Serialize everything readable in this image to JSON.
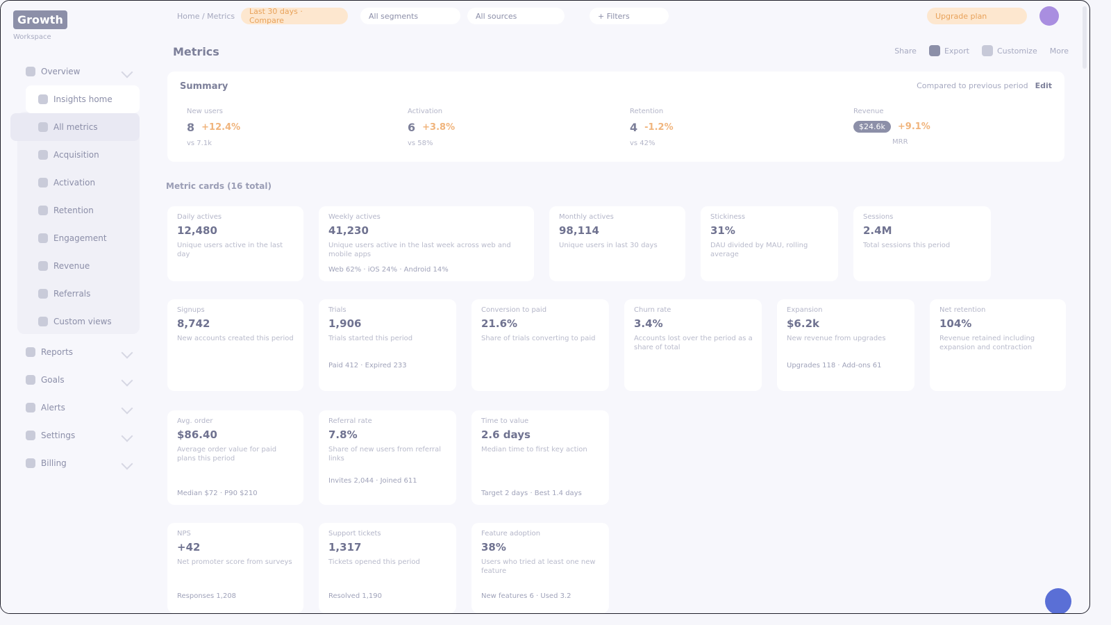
{
  "app": {
    "brand": "Growth",
    "brand_sub": "Workspace"
  },
  "sidebar": {
    "items": [
      {
        "label": "Overview"
      },
      {
        "label": "Insights home"
      },
      {
        "label": "All metrics"
      },
      {
        "label": "Acquisition"
      },
      {
        "label": "Activation"
      },
      {
        "label": "Retention"
      },
      {
        "label": "Engagement"
      },
      {
        "label": "Revenue"
      },
      {
        "label": "Referrals"
      },
      {
        "label": "Custom views"
      },
      {
        "label": "Reports"
      },
      {
        "label": "Goals"
      },
      {
        "label": "Alerts"
      },
      {
        "label": "Settings"
      },
      {
        "label": "Billing"
      }
    ]
  },
  "topbar": {
    "breadcrumb": "Home / Metrics",
    "range_pill": "Last 30 days · Compare",
    "segment_pill": "All segments",
    "source_pill": "All sources",
    "filters_pill": "+ Filters",
    "upgrade": "Upgrade plan"
  },
  "header": {
    "title": "Metrics",
    "actions": [
      "Share",
      "Export",
      "Customize",
      "More"
    ]
  },
  "summary": {
    "title": "Summary",
    "right_text": "Compared to previous period",
    "right_action": "Edit",
    "stats": [
      {
        "label": "New users",
        "num": "8",
        "val": "+12.4%",
        "foot": "vs 7.1k"
      },
      {
        "label": "Activation",
        "num": "6",
        "val": "+3.8%",
        "foot": "vs 58%"
      },
      {
        "label": "Retention",
        "num": "4",
        "val": "-1.2%",
        "foot": "vs 42%"
      },
      {
        "label": "Revenue",
        "chip": "$24.6k",
        "val": "+9.1%",
        "foot": "MRR"
      }
    ]
  },
  "section": {
    "label": "Metric cards (16 total)"
  },
  "cards": [
    {
      "title": "Daily actives",
      "value": "12,480",
      "desc": "Unique users active in the last day",
      "foot": ""
    },
    {
      "title": "Weekly actives",
      "value": "41,230",
      "desc": "Unique users active in the last week across web and mobile apps",
      "foot": "Web 62% · iOS 24% · Android 14%"
    },
    {
      "title": "Monthly actives",
      "value": "98,114",
      "desc": "Unique users in last 30 days",
      "foot": ""
    },
    {
      "title": "Stickiness",
      "value": "31%",
      "desc": "DAU divided by MAU, rolling average",
      "foot": ""
    },
    {
      "title": "Sessions",
      "value": "2.4M",
      "desc": "Total sessions this period",
      "foot": ""
    },
    {
      "title": "Signups",
      "value": "8,742",
      "desc": "New accounts created this period",
      "foot": ""
    },
    {
      "title": "Trials",
      "value": "1,906",
      "desc": "Trials started this period",
      "foot": "Paid 412 · Expired 233"
    },
    {
      "title": "Conversion to paid",
      "value": "21.6%",
      "desc": "Share of trials converting to paid",
      "foot": ""
    },
    {
      "title": "Churn rate",
      "value": "3.4%",
      "desc": "Accounts lost over the period as a share of total",
      "foot": ""
    },
    {
      "title": "Expansion",
      "value": "$6.2k",
      "desc": "New revenue from upgrades",
      "foot": "Upgrades 118 · Add-ons 61"
    },
    {
      "title": "Net retention",
      "value": "104%",
      "desc": "Revenue retained including expansion and contraction",
      "foot": ""
    },
    {
      "title": "Avg. order",
      "value": "$86.40",
      "desc": "Average order value for paid plans this period",
      "foot": "Median $72 · P90 $210"
    },
    {
      "title": "Referral rate",
      "value": "7.8%",
      "desc": "Share of new users from referral links",
      "foot": "Invites 2,044 · Joined 611"
    },
    {
      "title": "Time to value",
      "value": "2.6 days",
      "desc": "Median time to first key action",
      "foot": "Target 2 days · Best 1.4 days"
    },
    {
      "title": "NPS",
      "value": "+42",
      "desc": "Net promoter score from surveys",
      "foot": "Responses 1,208"
    },
    {
      "title": "Support tickets",
      "value": "1,317",
      "desc": "Tickets opened this period",
      "foot": "Resolved 1,190"
    },
    {
      "title": "Feature adoption",
      "value": "38%",
      "desc": "Users who tried at least one new feature",
      "foot": "New features 6 · Used 3.2"
    }
  ]
}
